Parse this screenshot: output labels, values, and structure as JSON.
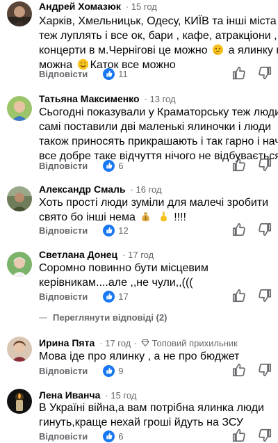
{
  "ui": {
    "reply_label": "Відповісти",
    "view_replies_label": "Переглянути відповіді (2)",
    "accent": "#1877f2",
    "secondary_text": "#65676b"
  },
  "comments": [
    {
      "author": "Андрей Хомазюк",
      "time": "15 год",
      "lines": [
        "Харків, Хмельницьк, Одесу, КИЇВ та інші міста",
        "теж луплять і все ок, бари , кафе, атракціони ,",
        "концерти в м.Чернігові це можно",
        "а ялинку не",
        "можна",
        "Каток все можно"
      ],
      "emojis": [
        "thinking-face",
        "smiling-face"
      ],
      "likes": "11"
    },
    {
      "author": "Татьяна Максименко",
      "time": "13 год",
      "lines": [
        "Сьогодні показували у Краматорську теж люди",
        "самі поставили дві маленькі ялиночки і люди",
        "також приносять прикрашають і так гарно  і наче",
        "все добре таке відчуття   нічого не відбувається."
      ],
      "likes": "6"
    },
    {
      "author": "Александр Смаль",
      "time": "16 год",
      "lines": [
        "Хоть прості люди зуміли для малечі зробити",
        "свято бо інші нема",
        "!!!!"
      ],
      "emojis": [
        "money-bag",
        "pointing-up"
      ],
      "likes": "12"
    },
    {
      "author": "Светлана Донец",
      "time": "17 год",
      "lines": [
        "Соромно повинно бути місцевим",
        "керівникам....але ,,не чули,,((("
      ],
      "likes": "17"
    },
    {
      "author": "Ирина Пята",
      "time": "17 год",
      "badge": "Топовий прихильник",
      "lines": [
        "Мова іде про ялинку , а не про бюджет"
      ],
      "likes": "9"
    },
    {
      "author": "Лена Иванча",
      "time": "15 год",
      "lines": [
        "В Україні війна,а вам потрібна ялинка люди",
        "гинуть,краще нехай гроші йдуть на ЗСУ"
      ],
      "likes": "6"
    }
  ]
}
